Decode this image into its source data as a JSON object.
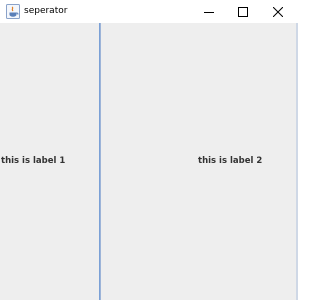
{
  "window": {
    "title": "seperator",
    "controls": {
      "minimize": "minimize-icon",
      "maximize": "maximize-icon",
      "close": "close-icon"
    }
  },
  "split_pane": {
    "left": {
      "label": "this is label 1"
    },
    "right": {
      "label": "this is label 2"
    },
    "divider_color": "#7aa0d6",
    "background": "#eeeeee"
  }
}
